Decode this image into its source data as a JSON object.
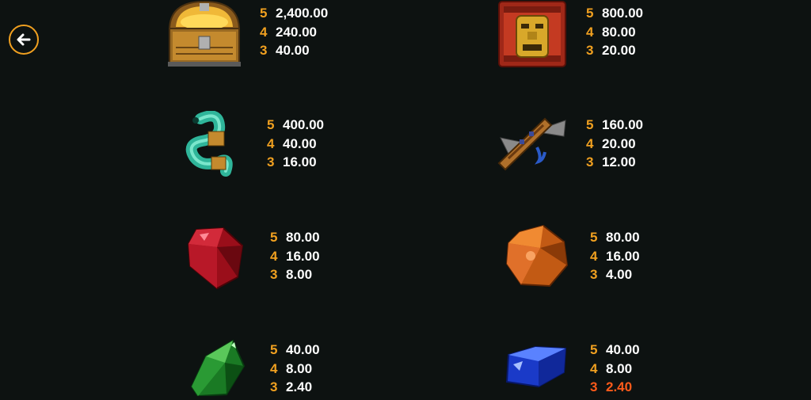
{
  "navigation": {
    "back_icon": "arrow-left-icon"
  },
  "symbols": [
    {
      "name": "treasure-chest",
      "icon": "treasure-chest-icon",
      "payouts": [
        {
          "count": "5",
          "amount": "2,400.00"
        },
        {
          "count": "4",
          "amount": "240.00"
        },
        {
          "count": "3",
          "amount": "40.00"
        }
      ]
    },
    {
      "name": "aztec-idol",
      "icon": "aztec-idol-icon",
      "payouts": [
        {
          "count": "5",
          "amount": "800.00"
        },
        {
          "count": "4",
          "amount": "80.00"
        },
        {
          "count": "3",
          "amount": "20.00"
        }
      ]
    },
    {
      "name": "serpent",
      "icon": "serpent-icon",
      "payouts": [
        {
          "count": "5",
          "amount": "400.00"
        },
        {
          "count": "4",
          "amount": "40.00"
        },
        {
          "count": "3",
          "amount": "16.00"
        }
      ]
    },
    {
      "name": "pan-flute",
      "icon": "pan-flute-icon",
      "payouts": [
        {
          "count": "5",
          "amount": "160.00"
        },
        {
          "count": "4",
          "amount": "20.00"
        },
        {
          "count": "3",
          "amount": "12.00"
        }
      ]
    },
    {
      "name": "red-gem",
      "icon": "red-gem-icon",
      "payouts": [
        {
          "count": "5",
          "amount": "80.00"
        },
        {
          "count": "4",
          "amount": "16.00"
        },
        {
          "count": "3",
          "amount": "8.00"
        }
      ]
    },
    {
      "name": "orange-gem",
      "icon": "orange-gem-icon",
      "payouts": [
        {
          "count": "5",
          "amount": "80.00"
        },
        {
          "count": "4",
          "amount": "16.00"
        },
        {
          "count": "3",
          "amount": "4.00"
        }
      ]
    },
    {
      "name": "green-gem",
      "icon": "green-gem-icon",
      "payouts": [
        {
          "count": "5",
          "amount": "40.00"
        },
        {
          "count": "4",
          "amount": "8.00"
        },
        {
          "count": "3",
          "amount": "2.40"
        }
      ]
    },
    {
      "name": "blue-gem",
      "icon": "blue-gem-icon",
      "payouts": [
        {
          "count": "5",
          "amount": "40.00"
        },
        {
          "count": "4",
          "amount": "8.00"
        },
        {
          "count": "3",
          "amount": "2.40",
          "highlight": true
        }
      ]
    }
  ],
  "colors": {
    "background": "#0d1211",
    "count": "#f0a020",
    "amount": "#ffffff",
    "highlight": "#ff5a1a"
  }
}
